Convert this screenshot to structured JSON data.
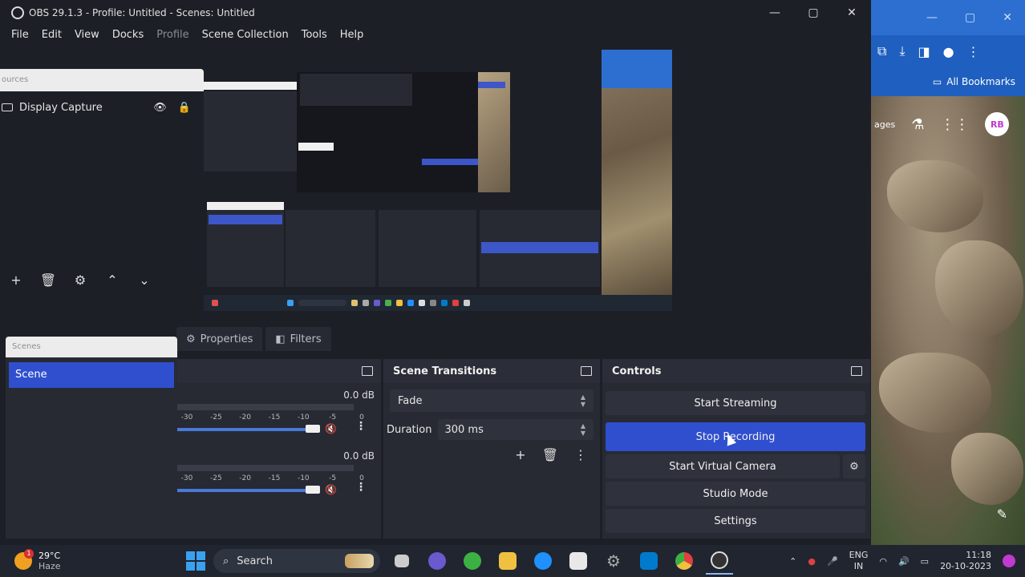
{
  "window": {
    "title": "OBS 29.1.3 - Profile: Untitled - Scenes: Untitled"
  },
  "menu": [
    "File",
    "Edit",
    "View",
    "Docks",
    "Profile",
    "Scene Collection",
    "Tools",
    "Help"
  ],
  "sources": {
    "header": "ources",
    "items": [
      {
        "label": "Display Capture"
      }
    ]
  },
  "tabs": {
    "properties": "Properties",
    "filters": "Filters"
  },
  "scenes": {
    "header": "Scenes",
    "items": [
      {
        "label": "Scene",
        "selected": true
      }
    ]
  },
  "mixer": {
    "channels": [
      {
        "db": "0.0 dB",
        "ticks": [
          "-30",
          "-25",
          "-20",
          "-15",
          "-10",
          "-5",
          "0"
        ]
      },
      {
        "db": "0.0 dB",
        "ticks": [
          "-30",
          "-25",
          "-20",
          "-15",
          "-10",
          "-5",
          "0"
        ]
      }
    ]
  },
  "transitions": {
    "title": "Scene Transitions",
    "selected": "Fade",
    "duration_label": "Duration",
    "duration_value": "300 ms"
  },
  "controls": {
    "title": "Controls",
    "start_streaming": "Start Streaming",
    "stop_recording": "Stop Recording",
    "start_virtual_camera": "Start Virtual Camera",
    "studio_mode": "Studio Mode",
    "settings": "Settings"
  },
  "browser": {
    "all_bookmarks": "All Bookmarks",
    "partial_text": "ages",
    "avatar": "RB"
  },
  "taskbar": {
    "weather_temp": "29°C",
    "weather_cond": "Haze",
    "weather_badge": "1",
    "search_label": "Search",
    "lang_line1": "ENG",
    "lang_line2": "IN",
    "time": "11:18",
    "date": "20-10-2023"
  },
  "colors": {
    "accent": "#2f4fcf",
    "panel": "#272a33",
    "background": "#1d1f26"
  }
}
